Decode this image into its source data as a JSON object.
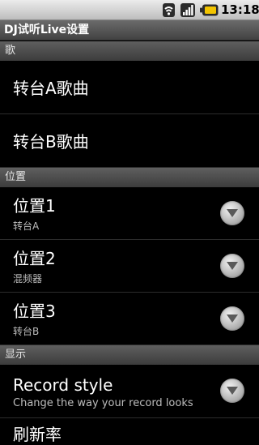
{
  "status_bar": {
    "time": "13:18"
  },
  "title_bar": {
    "title": "DJ试听Live设置"
  },
  "sections": {
    "song": {
      "header": "歌",
      "items": [
        "转台A歌曲",
        "转台B歌曲"
      ]
    },
    "position": {
      "header": "位置",
      "items": [
        {
          "title": "位置1",
          "summary": "转台A"
        },
        {
          "title": "位置2",
          "summary": "混频器"
        },
        {
          "title": "位置3",
          "summary": "转台B"
        }
      ]
    },
    "display": {
      "header": "显示",
      "items": [
        {
          "title": "Record style",
          "summary": "Change the way your record looks"
        }
      ],
      "partial_next_title": "刷新率"
    }
  }
}
